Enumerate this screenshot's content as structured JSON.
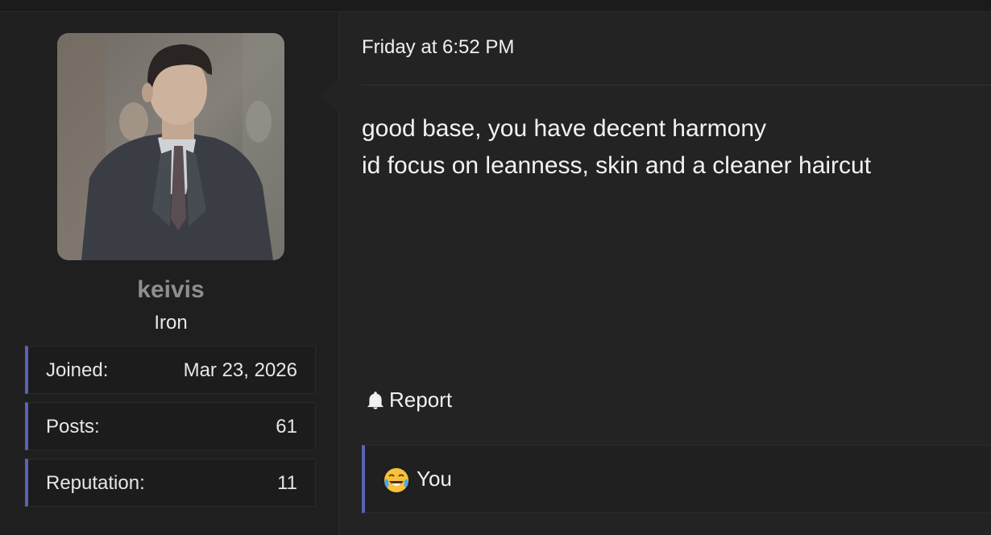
{
  "post": {
    "timestamp": "Friday at 6:52 PM",
    "body_lines": [
      "good base, you have decent harmony",
      "id focus on leanness, skin and a cleaner haircut"
    ],
    "report_label": "Report",
    "reactions": {
      "emoji": "crying-laughing-emoji",
      "users": "You"
    }
  },
  "user": {
    "name": "keivis",
    "rank": "Iron",
    "stats": [
      {
        "label": "Joined:",
        "value": "Mar 23, 2026"
      },
      {
        "label": "Posts:",
        "value": "61"
      },
      {
        "label": "Reputation:",
        "value": "11"
      }
    ]
  },
  "colors": {
    "accent": "#5b64b4",
    "username": "#8e8e8e",
    "background": "#1b1b1b",
    "message_bg": "#232323"
  }
}
